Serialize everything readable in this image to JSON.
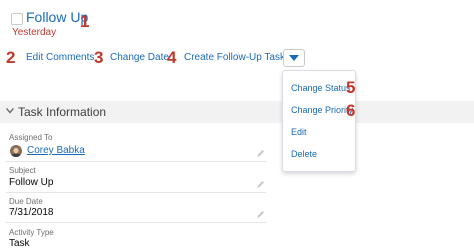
{
  "task": {
    "title": "Follow Up",
    "due_label": "Yesterday"
  },
  "annotations": [
    "1",
    "2",
    "3",
    "4",
    "5",
    "6"
  ],
  "actions": {
    "edit_comments": "Edit Comments",
    "change_date": "Change Date",
    "create_follow_up": "Create Follow-Up Task"
  },
  "menu": {
    "items": [
      "Change Status",
      "Change Priority",
      "Edit",
      "Delete"
    ]
  },
  "section": {
    "title": "Task Information"
  },
  "fields": {
    "assigned_to": {
      "label": "Assigned To",
      "value": "Corey Babka"
    },
    "subject": {
      "label": "Subject",
      "value": "Follow Up"
    },
    "due_date": {
      "label": "Due Date",
      "value": "7/31/2018"
    },
    "activity_type": {
      "label": "Activity Type",
      "value": "Task"
    }
  },
  "icons": {
    "dropdown": "chevron-down-icon",
    "section_toggle": "chevron-down-icon",
    "edit": "pencil-icon"
  },
  "colors": {
    "link": "#1a6bb8",
    "annotation": "#c0392b",
    "due_red": "#c23934",
    "section_bg": "#f3f2f2"
  }
}
